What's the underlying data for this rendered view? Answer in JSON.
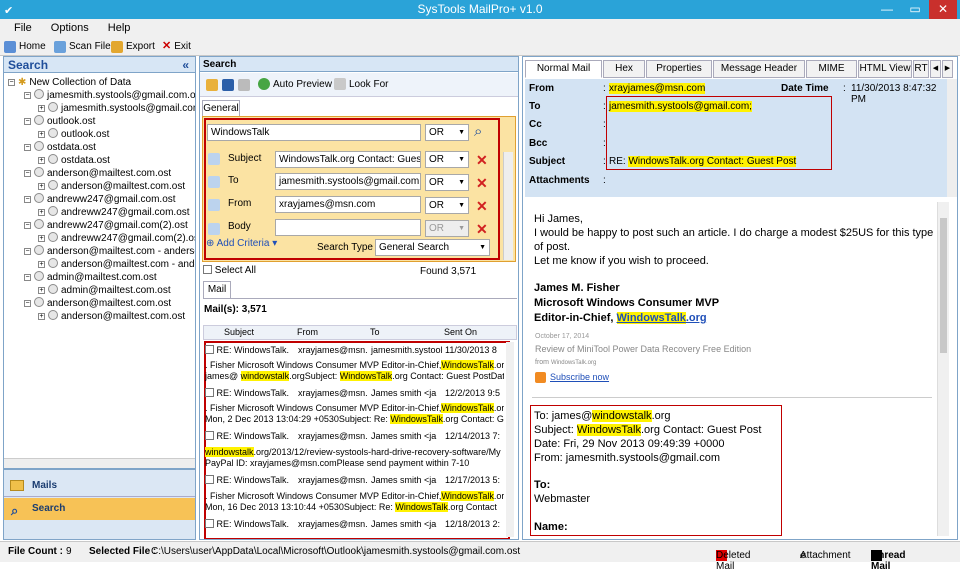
{
  "window": {
    "title": "SysTools MailPro+ v1.0",
    "minimize": "—",
    "restore": "▭",
    "close": "✕"
  },
  "menu": [
    "File",
    "Options",
    "Help"
  ],
  "toolbar": {
    "home": "Home",
    "scan_file": "Scan File",
    "export": "Export",
    "exit": "Exit"
  },
  "left": {
    "title": "Search",
    "collapse": "«",
    "tree": [
      {
        "label": "New Collection of Data",
        "level": 0
      },
      {
        "label": "jamesmith.systools@gmail.com.ost",
        "level": 1
      },
      {
        "label": "jamesmith.systools@gmail.com.ost",
        "level": 2
      },
      {
        "label": "outlook.ost",
        "level": 1
      },
      {
        "label": "outlook.ost",
        "level": 2
      },
      {
        "label": "ostdata.ost",
        "level": 1
      },
      {
        "label": "ostdata.ost",
        "level": 2
      },
      {
        "label": "anderson@mailtest.com.ost",
        "level": 1
      },
      {
        "label": "anderson@mailtest.com.ost",
        "level": 2
      },
      {
        "label": "andreww247@gmail.com.ost",
        "level": 1
      },
      {
        "label": "andreww247@gmail.com.ost",
        "level": 2
      },
      {
        "label": "andreww247@gmail.com(2).ost",
        "level": 1
      },
      {
        "label": "andreww247@gmail.com(2).ost",
        "level": 2
      },
      {
        "label": "anderson@mailtest.com - anderson.",
        "level": 1
      },
      {
        "label": "anderson@mailtest.com - anders",
        "level": 2
      },
      {
        "label": "admin@mailtest.com.ost",
        "level": 1
      },
      {
        "label": "admin@mailtest.com.ost",
        "level": 2
      },
      {
        "label": "anderson@mailtest.com.ost",
        "level": 1
      },
      {
        "label": "anderson@mailtest.com.ost",
        "level": 2
      }
    ],
    "nav_mails": "Mails",
    "nav_search": "Search"
  },
  "search": {
    "title": "Search",
    "auto_preview": "Auto Preview",
    "look_for": "Look For",
    "tab_general": "General",
    "keyword": "WindowsTalk",
    "op1": "OR",
    "subject_label": "Subject",
    "subject_value": "WindowsTalk.org Contact: Guest Po",
    "op2": "OR",
    "to_label": "To",
    "to_value": "jamesmith.systools@gmail.com",
    "op3": "OR",
    "from_label": "From",
    "from_value": "xrayjames@msn.com",
    "op4": "OR",
    "body_label": "Body",
    "body_value": "",
    "op5": "OR",
    "add_criteria": "Add Criteria",
    "search_type_label": "Search Type",
    "search_type_value": "General Search",
    "select_all": "Select All",
    "found": "Found  3,571",
    "mail_tab": "Mail",
    "mails_count": "Mail(s):  3,571",
    "columns": [
      "Subject",
      "From",
      "To",
      "Sent On"
    ],
    "rows": [
      {
        "subject": "RE: WindowsTalk.",
        "from": "xrayjames@msn.",
        "to": "jamesmith.systool",
        "sent": "11/30/2013 8",
        "snip1_pre": ". Fisher Microsoft Windows Consumer MVP Editor-in-Chief,",
        "snip1_hl": "WindowsTalk",
        "snip1_post": ".orgTo:",
        "snip2_pre": "james@ ",
        "snip2_hl": "windowstalk",
        "snip2_mid": ".orgSubject: ",
        "snip2_hl2": "WindowsTalk",
        "snip2_post": ".org Contact: Guest PostDate: Fri,"
      },
      {
        "subject": "RE: WindowsTalk.",
        "from": "xrayjames@msn.",
        "to": "James smith <ja",
        "sent": "12/2/2013 9:5",
        "snip1_pre": ". Fisher Microsoft Windows Consumer MVP Editor-in-Chief,",
        "snip1_hl": "WindowsTalk",
        "snip1_post": ".orgDate:",
        "snip2_pre": "Mon, 2 Dec 2013 13:04:29 +0530Subject: Re:  ",
        "snip2_hl": "WindowsTalk",
        "snip2_mid": ".org Contact: Gues",
        "snip2_hl2": "",
        "snip2_post": ""
      },
      {
        "subject": "RE: WindowsTalk.",
        "from": "xrayjames@msn.",
        "to": "James smith <ja",
        "sent": "12/14/2013 7:",
        "snip1_pre": "",
        "snip1_hl": "windowstalk",
        "snip1_post": ".org/2013/12/review-systools-hard-drive-recovery-software/My",
        "snip2_pre": "PayPal ID: xrayjames@msn.comPlease send payment within 7-10",
        "snip2_hl": "",
        "snip2_mid": "",
        "snip2_hl2": "",
        "snip2_post": ""
      },
      {
        "subject": "RE: WindowsTalk.",
        "from": "xrayjames@msn.",
        "to": "James smith <ja",
        "sent": "12/17/2013 5:",
        "snip1_pre": ". Fisher Microsoft Windows Consumer MVP Editor-in-Chief,",
        "snip1_hl": "WindowsTalk",
        "snip1_post": ".orgDate:",
        "snip2_pre": "Mon, 16 Dec 2013 13:10:44 +0530Subject: Re:  ",
        "snip2_hl": "WindowsTalk",
        "snip2_mid": ".org Contact",
        "snip2_hl2": "",
        "snip2_post": ""
      },
      {
        "subject": "RE: WindowsTalk.",
        "from": "xrayjames@msn.",
        "to": "James smith <ja",
        "sent": "12/18/2013 2:",
        "snip1_pre": "",
        "snip1_hl": "",
        "snip1_post": "",
        "snip2_pre": "",
        "snip2_hl": "",
        "snip2_mid": "",
        "snip2_hl2": "",
        "snip2_post": ""
      }
    ]
  },
  "viewer": {
    "tabs": [
      "Normal Mail View",
      "Hex View",
      "Properties View",
      "Message Header View",
      "MIME View",
      "HTML View",
      "RT"
    ],
    "from_label": "From",
    "from_value": "xrayjames@msn.com",
    "date_label": "Date Time",
    "date_sep": ":",
    "date_value": "11/30/2013 8:47:32 PM",
    "to_label": "To",
    "to_value": "jamesmith.systools@gmail.com;",
    "cc_label": "Cc",
    "bcc_label": "Bcc",
    "subject_label": "Subject",
    "subject_pre": "RE: ",
    "subject_hl": "WindowsTalk.org Contact: Guest Post",
    "attachments_label": "Attachments",
    "colon": ":",
    "body": {
      "greeting": "Hi James,",
      "line1": "I would be happy to post such an article. I do charge a modest $25US for this type",
      "line2": "of post.",
      "line3": "Let me know if you wish to proceed.",
      "sig_name": "James M. Fisher",
      "sig_title": "Microsoft Windows Consumer MVP",
      "sig_role": "Editor-in-Chief, ",
      "sig_link_hl": "WindowsTalk",
      "sig_link_rest": ".org",
      "date_small": "October 17, 2014",
      "review": "Review of MiniTool Power Data Recovery Free Edition",
      "from_small": "from",
      "site_small": "WindowsTalk.org",
      "subscribe": "Subscribe now",
      "q_to_pre": "To: james@",
      "q_to_hl": "windowstalk",
      "q_to_post": ".org",
      "q_subj_pre": "Subject: ",
      "q_subj_hl": "WindowsTalk",
      "q_subj_post": ".org Contact: Guest Post",
      "q_date": "Date: Fri, 29 Nov 2013 09:49:39 +0000",
      "q_from": "From: jamesmith.systools@gmail.com",
      "q_to2": "To:",
      "q_webmaster": "Webmaster",
      "q_name": "Name:"
    }
  },
  "status": {
    "file_count_label": "File Count :",
    "file_count": "9",
    "selected_label": "Selected File :",
    "selected_path": "C:\\Users\\user\\AppData\\Local\\Microsoft\\Outlook\\jamesmith.systools@gmail.com.ost",
    "deleted": "Deleted Mail",
    "attachment": "Attachment",
    "unread": "Unread Mail"
  },
  "colors": {
    "titlebar": "#2aa3d8",
    "highlight": "#fff200",
    "red_box": "#c00000",
    "link": "#1f4fb8",
    "search_panel": "#fbe3a3"
  }
}
